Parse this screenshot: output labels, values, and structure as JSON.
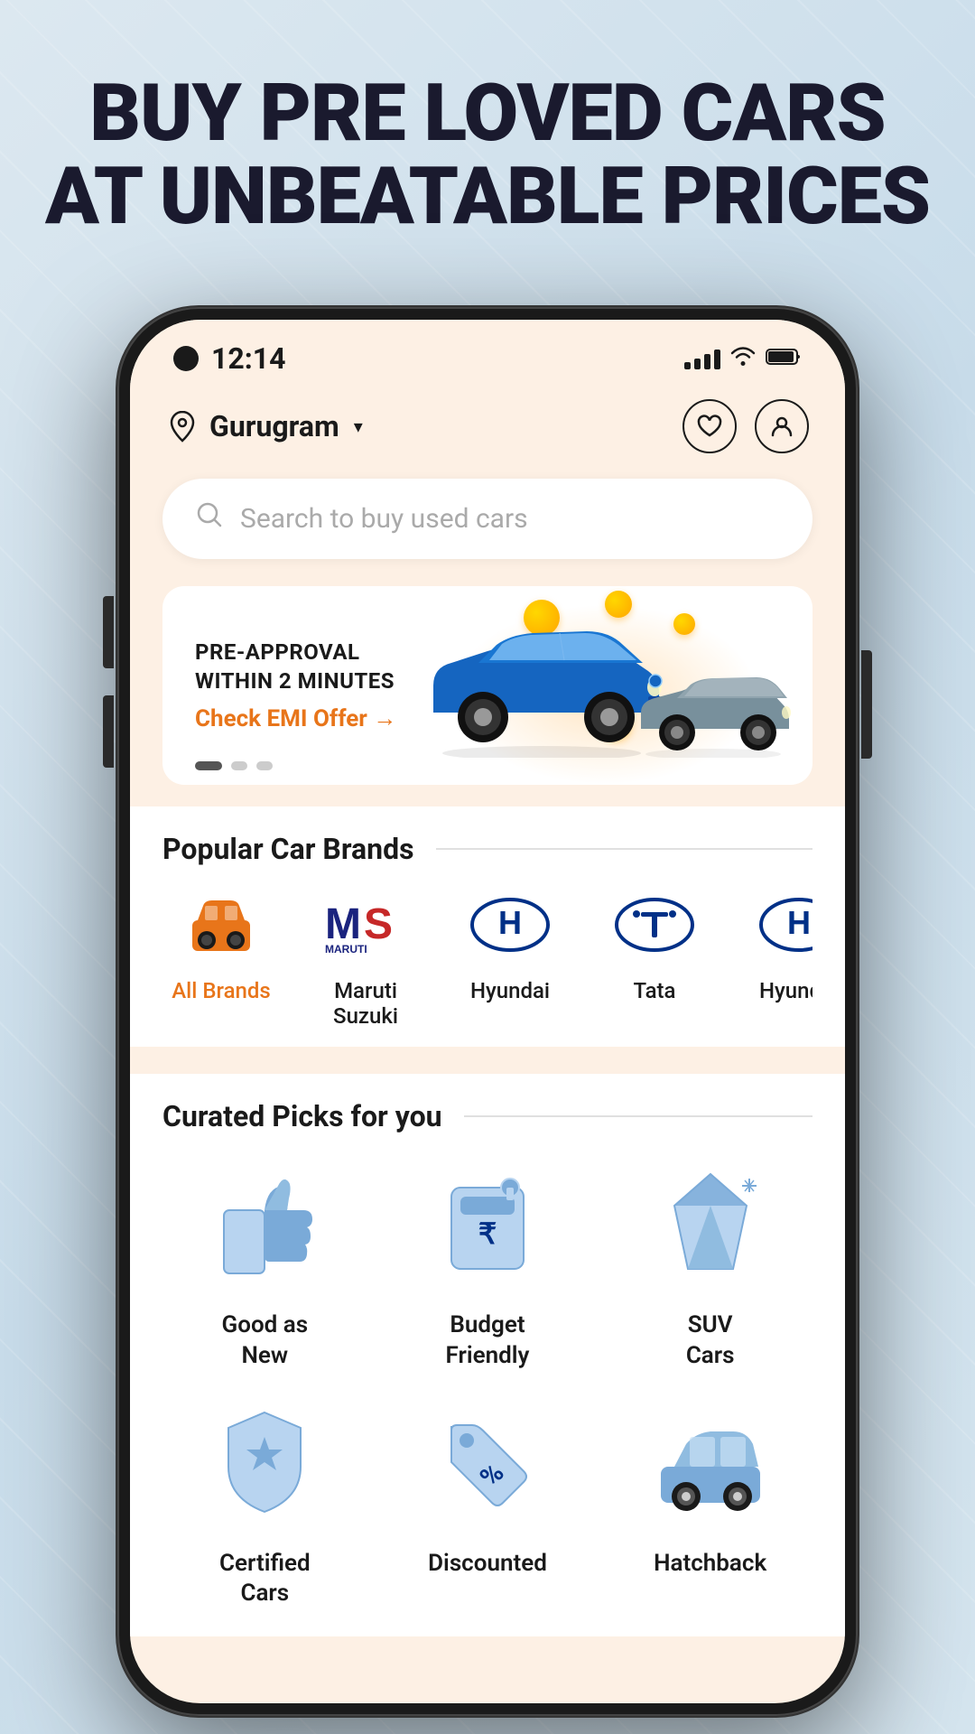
{
  "hero": {
    "line1": "BUY PRE LOVED CARS",
    "line2": "AT UNBEATABLE PRICES"
  },
  "statusBar": {
    "time": "12:14",
    "showSignal": true,
    "showWifi": true,
    "showBattery": true
  },
  "header": {
    "location": "Gurugram",
    "locationIcon": "📍",
    "wishlistIcon": "♡",
    "profileIcon": "👤"
  },
  "search": {
    "placeholder": "Search to buy used cars"
  },
  "banner": {
    "line1": "PRE-APPROVAL",
    "line2": "WITHIN 2 MINUTES",
    "cta": "Check EMI Offer →"
  },
  "popularBrands": {
    "title": "Popular Car Brands",
    "items": [
      {
        "name": "All Brands",
        "active": true
      },
      {
        "name": "Maruti Suzuki",
        "active": false
      },
      {
        "name": "Hyundai",
        "active": false
      },
      {
        "name": "Tata",
        "active": false
      },
      {
        "name": "Hyundai",
        "active": false
      }
    ]
  },
  "curatedPicks": {
    "title": "Curated Picks for you",
    "items": [
      {
        "label": "Good as New",
        "icon": "thumb"
      },
      {
        "label": "Budget Friendly",
        "icon": "wallet"
      },
      {
        "label": "SUV Cars",
        "icon": "diamond"
      },
      {
        "label": "Certified Cars",
        "icon": "shield"
      },
      {
        "label": "Discounted",
        "icon": "tag"
      },
      {
        "label": "Hatchback",
        "icon": "car"
      }
    ]
  },
  "slideDots": [
    {
      "active": true
    },
    {
      "active": false
    },
    {
      "active": false
    }
  ]
}
